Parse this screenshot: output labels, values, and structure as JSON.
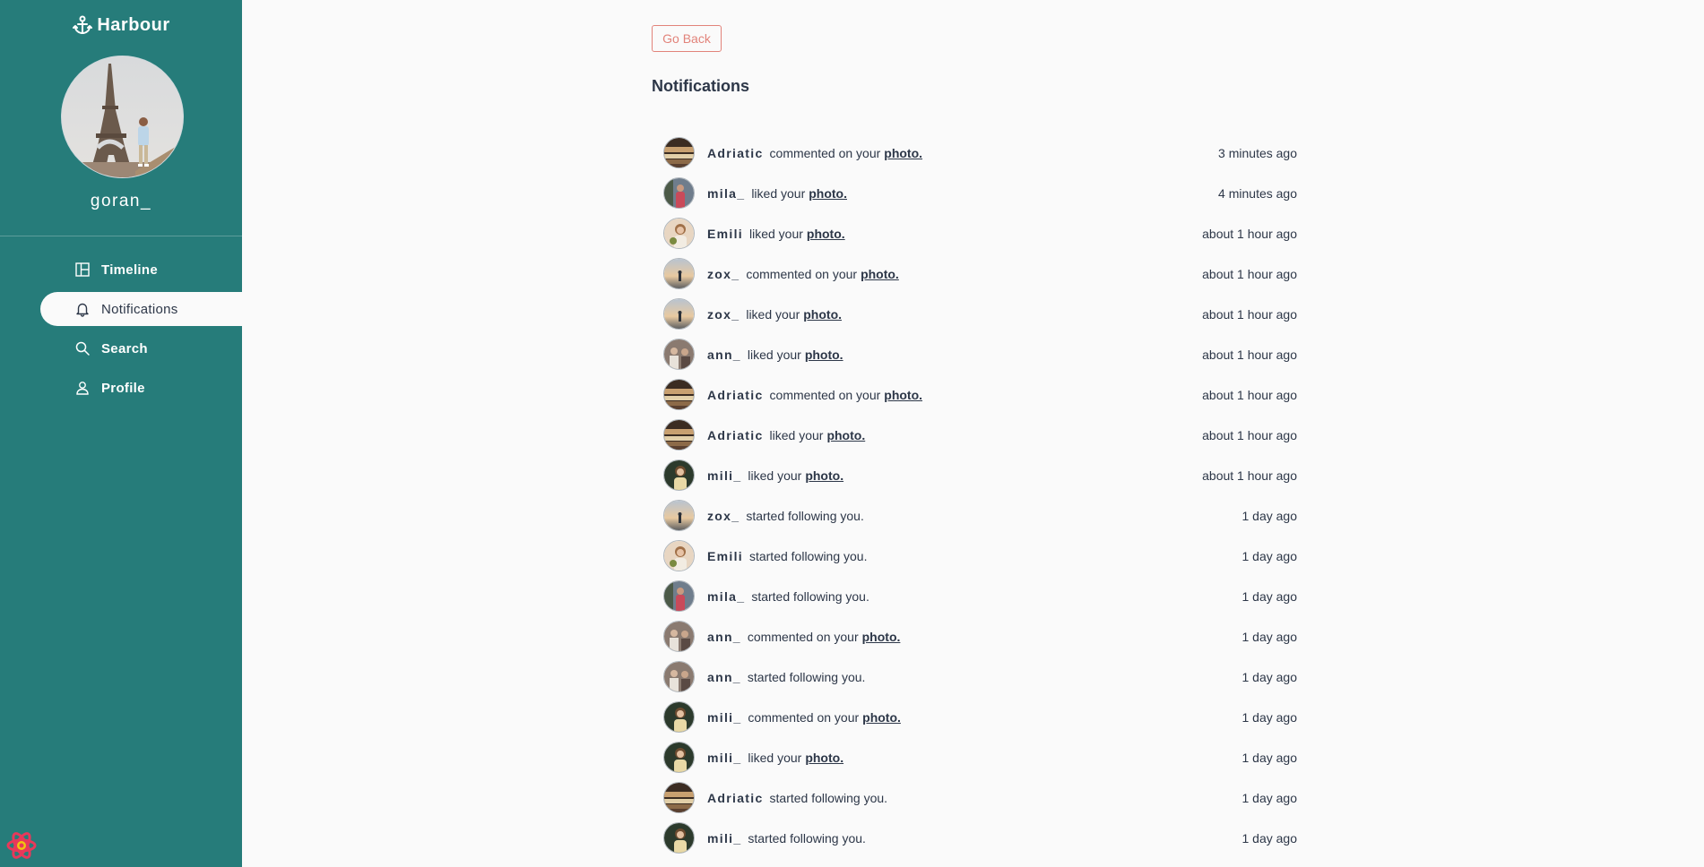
{
  "sidebar": {
    "brand": "Harbour",
    "username": "goran_",
    "nav": [
      {
        "label": "Timeline",
        "icon": "layout-icon"
      },
      {
        "label": "Notifications",
        "icon": "bell-icon"
      },
      {
        "label": "Search",
        "icon": "search-icon"
      },
      {
        "label": "Profile",
        "icon": "user-icon"
      }
    ],
    "active": "Notifications"
  },
  "main": {
    "back_label": "Go Back",
    "title": "Notifications",
    "link_label": "photo.",
    "notifications": [
      {
        "user": "Adriatic",
        "action": "commented on your",
        "link": true,
        "time": "3 minutes ago",
        "avatar": "adriatic"
      },
      {
        "user": "mila_",
        "action": "liked your",
        "link": true,
        "time": "4 minutes ago",
        "avatar": "mila"
      },
      {
        "user": "Emili",
        "action": "liked your",
        "link": true,
        "time": "about 1 hour ago",
        "avatar": "emili"
      },
      {
        "user": "zox_",
        "action": "commented on your",
        "link": true,
        "time": "about 1 hour ago",
        "avatar": "zox"
      },
      {
        "user": "zox_",
        "action": "liked your",
        "link": true,
        "time": "about 1 hour ago",
        "avatar": "zox"
      },
      {
        "user": "ann_",
        "action": "liked your",
        "link": true,
        "time": "about 1 hour ago",
        "avatar": "ann"
      },
      {
        "user": "Adriatic",
        "action": "commented on your",
        "link": true,
        "time": "about 1 hour ago",
        "avatar": "adriatic"
      },
      {
        "user": "Adriatic",
        "action": "liked your",
        "link": true,
        "time": "about 1 hour ago",
        "avatar": "adriatic"
      },
      {
        "user": "mili_",
        "action": "liked your",
        "link": true,
        "time": "about 1 hour ago",
        "avatar": "mili"
      },
      {
        "user": "zox_",
        "action": "started following you.",
        "link": false,
        "time": "1 day ago",
        "avatar": "zox"
      },
      {
        "user": "Emili",
        "action": "started following you.",
        "link": false,
        "time": "1 day ago",
        "avatar": "emili"
      },
      {
        "user": "mila_",
        "action": "started following you.",
        "link": false,
        "time": "1 day ago",
        "avatar": "mila"
      },
      {
        "user": "ann_",
        "action": "commented on your",
        "link": true,
        "time": "1 day ago",
        "avatar": "ann"
      },
      {
        "user": "ann_",
        "action": "started following you.",
        "link": false,
        "time": "1 day ago",
        "avatar": "ann"
      },
      {
        "user": "mili_",
        "action": "commented on your",
        "link": true,
        "time": "1 day ago",
        "avatar": "mili"
      },
      {
        "user": "mili_",
        "action": "liked your",
        "link": true,
        "time": "1 day ago",
        "avatar": "mili"
      },
      {
        "user": "Adriatic",
        "action": "started following you.",
        "link": false,
        "time": "1 day ago",
        "avatar": "adriatic"
      },
      {
        "user": "mili_",
        "action": "started following you.",
        "link": false,
        "time": "1 day ago",
        "avatar": "mili"
      }
    ]
  },
  "colors": {
    "sidebar_bg": "#267c7a",
    "page_bg": "#fafafa",
    "back_button": "#e2837a",
    "text": "#2d3748"
  }
}
